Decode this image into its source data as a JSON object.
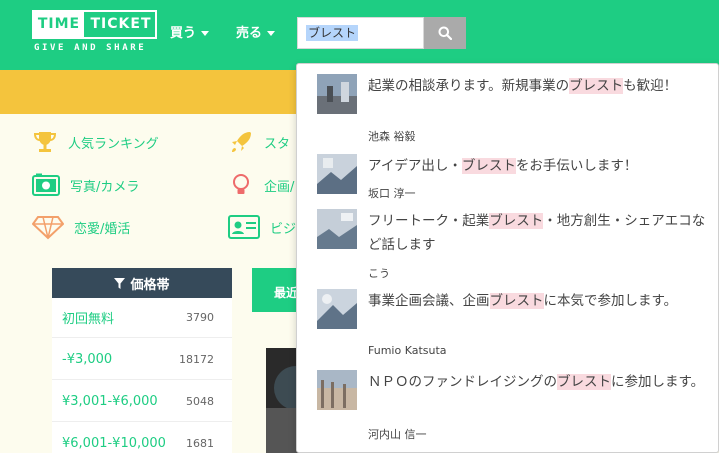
{
  "header": {
    "logo_left": "TIME",
    "logo_right": "TICKET",
    "logo_sub": "GIVE AND SHARE",
    "nav_buy": "買う",
    "nav_sell": "売る",
    "search_value": "ブレスト"
  },
  "categories": [
    {
      "label": "人気ランキング",
      "icon": "trophy-icon"
    },
    {
      "label": "スタ",
      "icon": "rocket-icon"
    },
    {
      "label": "写真/カメラ",
      "icon": "camera-icon"
    },
    {
      "label": "企画/",
      "icon": "lightbulb-icon"
    },
    {
      "label": "恋愛/婚活",
      "icon": "diamond-icon"
    },
    {
      "label": "ビジ",
      "icon": "id-card-icon"
    }
  ],
  "price_filter": {
    "title": "価格帯",
    "rows": [
      {
        "label": "初回無料",
        "count": "3790"
      },
      {
        "label": "-¥3,000",
        "count": "18172"
      },
      {
        "label": "¥3,001-¥6,000",
        "count": "5048"
      },
      {
        "label": "¥6,001-¥10,000",
        "count": "1681"
      }
    ]
  },
  "sort_tab": "最近",
  "suggestions": [
    {
      "title_before": "起業の相談承ります。新規事業の",
      "highlight": "ブレスト",
      "title_after": "も歓迎！",
      "author": "池森 裕毅"
    },
    {
      "title_before": "アイデア出し・",
      "highlight": "ブレスト",
      "title_after": "をお手伝いします！",
      "author": "坂口 淳一"
    },
    {
      "title_before": "フリートーク・起業",
      "highlight": "ブレスト",
      "title_after": "・地方創生・シェアエコなど話します",
      "author": "こう"
    },
    {
      "title_before": "事業企画会議、企画",
      "highlight": "ブレスト",
      "title_after": "に本気で参加します。",
      "author": "Fumio Katsuta"
    },
    {
      "title_before": "ＮＰＯのファンドレイジングの",
      "highlight": "ブレスト",
      "title_after": "に参加します。",
      "author": "河内山 信一"
    }
  ],
  "colors": {
    "brand_green": "#1ecd83",
    "band_yellow": "#f4c43d",
    "price_header": "#364a5a",
    "highlight_pink": "#f9dadf"
  }
}
